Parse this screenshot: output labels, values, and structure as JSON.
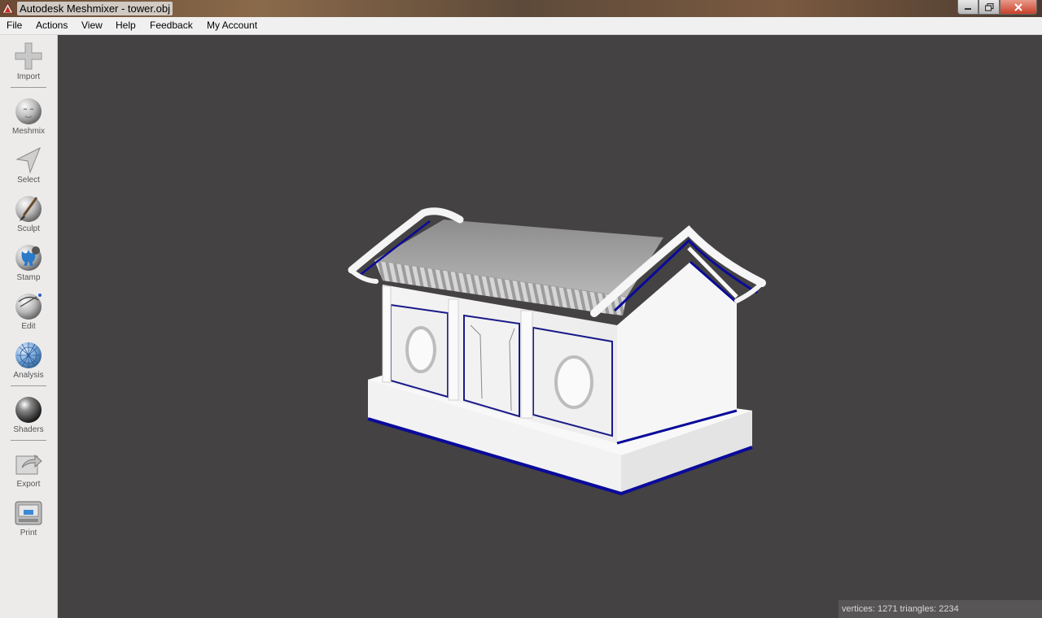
{
  "window": {
    "title": "Autodesk Meshmixer - tower.obj",
    "minimize_icon": "minimize-icon",
    "maximize_icon": "restore-icon",
    "close_icon": "close-icon"
  },
  "menu": [
    "File",
    "Actions",
    "View",
    "Help",
    "Feedback",
    "My Account"
  ],
  "tools": [
    {
      "label": "Import",
      "icon": "import-plus-icon"
    },
    {
      "label": "Meshmix",
      "icon": "meshmix-sphere-icon"
    },
    {
      "label": "Select",
      "icon": "select-arrow-icon"
    },
    {
      "label": "Sculpt",
      "icon": "sculpt-brush-icon"
    },
    {
      "label": "Stamp",
      "icon": "stamp-icon"
    },
    {
      "label": "Edit",
      "icon": "edit-sphere-icon"
    },
    {
      "label": "Analysis",
      "icon": "analysis-mesh-icon"
    },
    {
      "label": "Shaders",
      "icon": "shaders-sphere-icon"
    },
    {
      "label": "Export",
      "icon": "export-icon"
    },
    {
      "label": "Print",
      "icon": "print-icon"
    }
  ],
  "status": {
    "text": "vertices: 1271 triangles: 2234"
  },
  "colors": {
    "viewport_bg": "#444242",
    "mesh_edge_highlight": "#0000a0",
    "sidebar_bg": "#ecebea"
  }
}
